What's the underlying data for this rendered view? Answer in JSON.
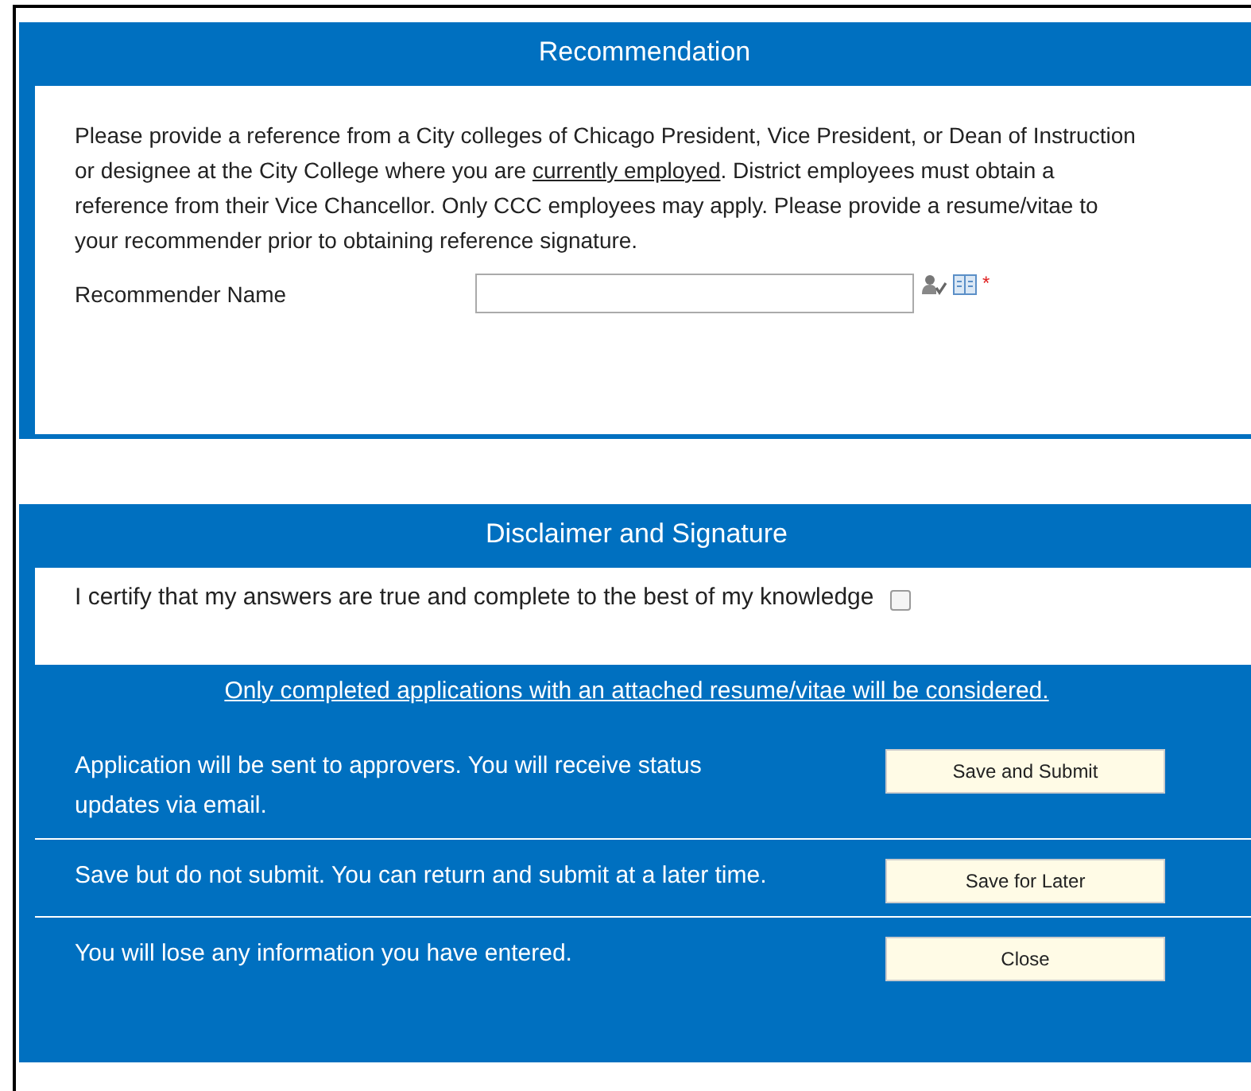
{
  "recommendation": {
    "title": "Recommendation",
    "instructions": {
      "before": "Please provide a reference from a City colleges of Chicago President, Vice President, or Dean of Instruction or designee at the City College where you are ",
      "underlined": "currently employed",
      "after": ". District employees  must obtain a reference from their Vice Chancellor. Only CCC employees may apply. Please provide a resume/vitae to your recommender prior to obtaining reference signature."
    },
    "field": {
      "label": "Recommender Name",
      "required_mark": "*"
    }
  },
  "disclaimer": {
    "title": "Disclaimer and Signature",
    "certify": {
      "label": "I certify that my answers are true and complete to the best of my knowledge",
      "checked": false
    },
    "notice": "Only completed applications with an attached resume/vitae will be considered.",
    "actions": [
      {
        "description": "Application will be sent to approvers. You will receive status updates via email.",
        "button": "Save and Submit"
      },
      {
        "description": "Save but do not submit. You can return and submit at a later time.",
        "button": "Save for Later"
      },
      {
        "description": "You will lose any information you have entered.",
        "button": "Close"
      }
    ]
  }
}
